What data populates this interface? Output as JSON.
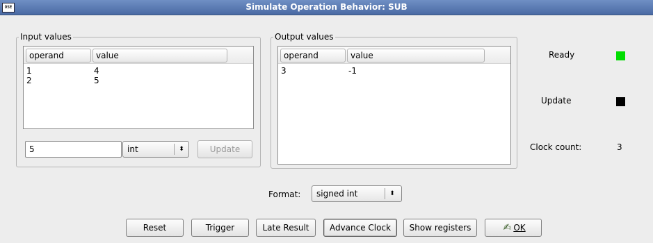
{
  "window": {
    "icon_text": "OSE",
    "title": "Simulate Operation Behavior: SUB"
  },
  "input_group": {
    "title": "Input values",
    "columns": [
      "operand",
      "value"
    ],
    "rows": [
      {
        "operand": "1",
        "value": "4"
      },
      {
        "operand": "2",
        "value": "5"
      }
    ],
    "edit_value": "5",
    "type_selected": "int",
    "update_label": "Update"
  },
  "output_group": {
    "title": "Output values",
    "columns": [
      "operand",
      "value"
    ],
    "rows": [
      {
        "operand": "3",
        "value": "-1"
      }
    ]
  },
  "status": {
    "ready_label": "Ready",
    "ready_color": "#00dd00",
    "update_label": "Update",
    "update_color": "#000000",
    "clock_label": "Clock count:",
    "clock_value": "3"
  },
  "format": {
    "label": "Format:",
    "selected": "signed int"
  },
  "buttons": {
    "reset": "Reset",
    "trigger": "Trigger",
    "late_result": "Late Result",
    "advance_clock": "Advance Clock",
    "show_registers": "Show registers",
    "ok": "OK"
  },
  "icons": {
    "ok": "ok-check-icon",
    "combo_arrow": "up-down-arrows-icon"
  }
}
